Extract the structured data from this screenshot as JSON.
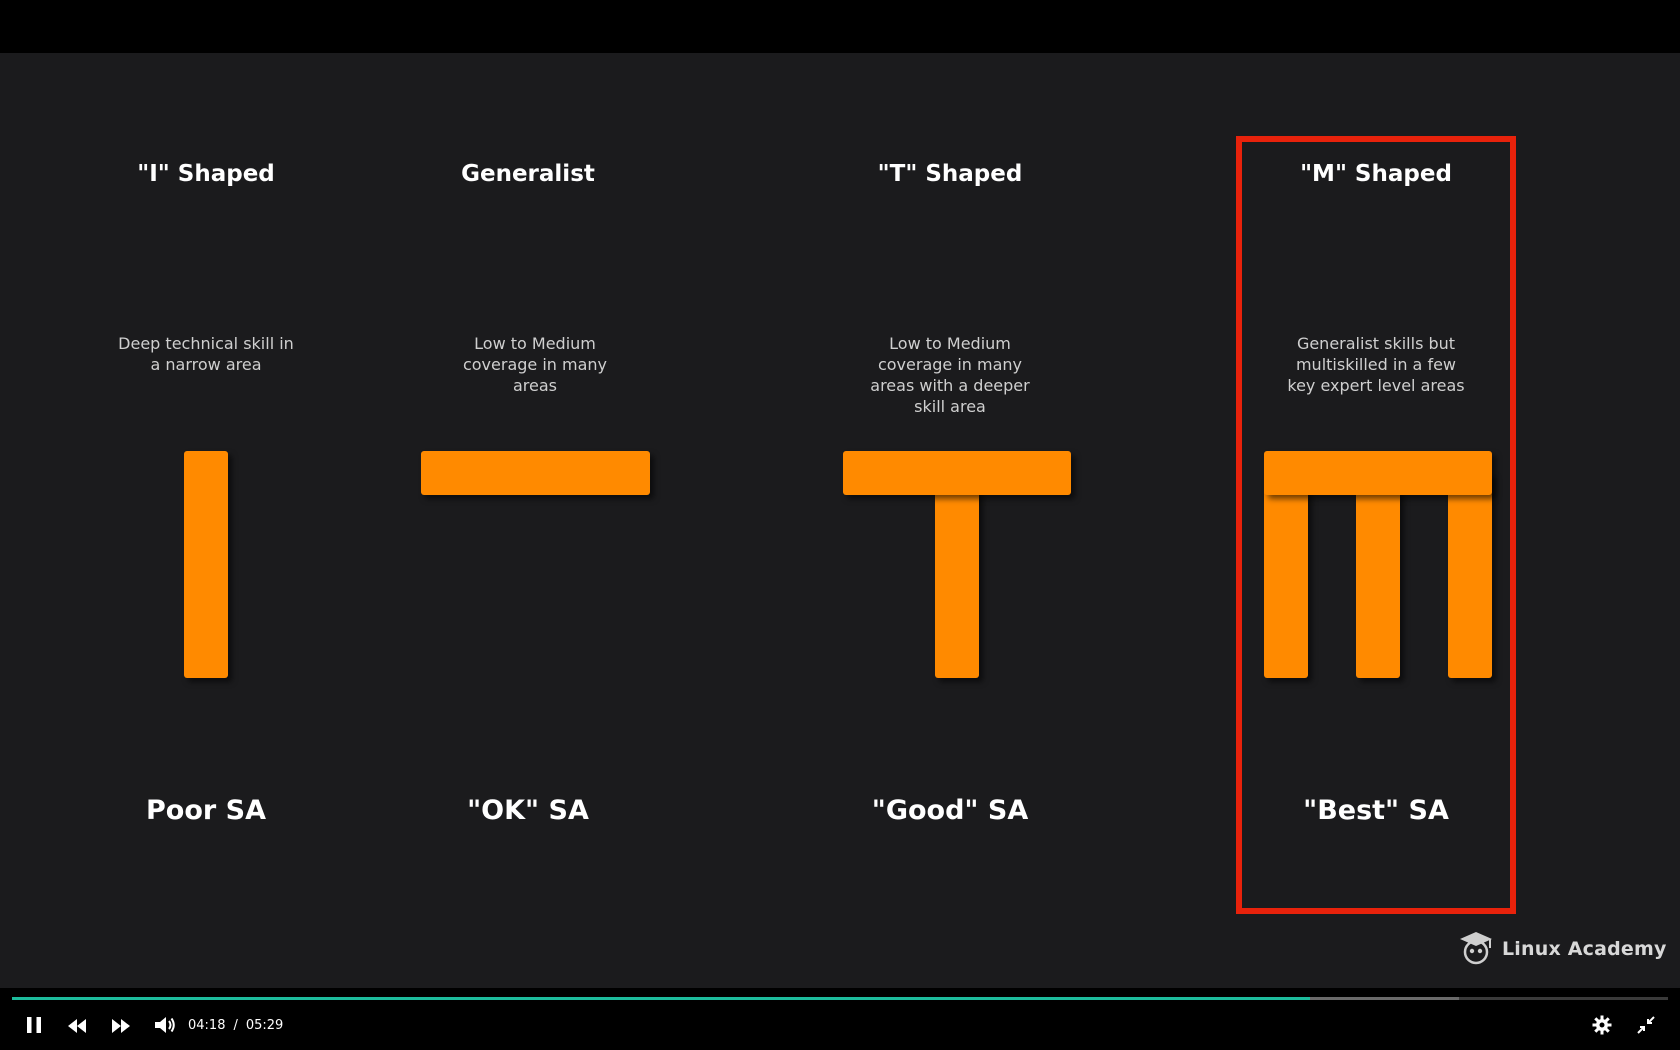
{
  "slide": {
    "columns": [
      {
        "heading": "\"I\" Shaped",
        "description": "Deep technical skill in a narrow area",
        "caption": "Poor SA"
      },
      {
        "heading": "Generalist",
        "description": "Low to Medium coverage in many areas",
        "caption": "\"OK\" SA"
      },
      {
        "heading": "\"T\" Shaped",
        "description": "Low to Medium coverage in many areas with a deeper skill area",
        "caption": "\"Good\" SA"
      },
      {
        "heading": "\"M\" Shaped",
        "description": "Generalist skills but multiskilled in a few key expert level areas",
        "caption": "\"Best\" SA"
      }
    ],
    "highlighted_column": 3,
    "colors": {
      "shape": "#ff8a00",
      "highlight": "#e8220b",
      "background": "#1b1b1d"
    },
    "logo": {
      "text": "Linux Academy",
      "icon": "owl-graduation-cap-icon"
    }
  },
  "player": {
    "current_time": "04:18",
    "separator": "/",
    "duration": "05:29",
    "progress_fraction": 0.784,
    "buffered_fraction": 0.874,
    "progress_color": "#1dbb9c",
    "buttons": {
      "play_pause": "pause-icon",
      "rewind": "rewind-icon",
      "forward": "fast-forward-icon",
      "volume": "volume-icon",
      "settings": "gear-icon",
      "fullscreen": "exit-fullscreen-icon"
    }
  }
}
